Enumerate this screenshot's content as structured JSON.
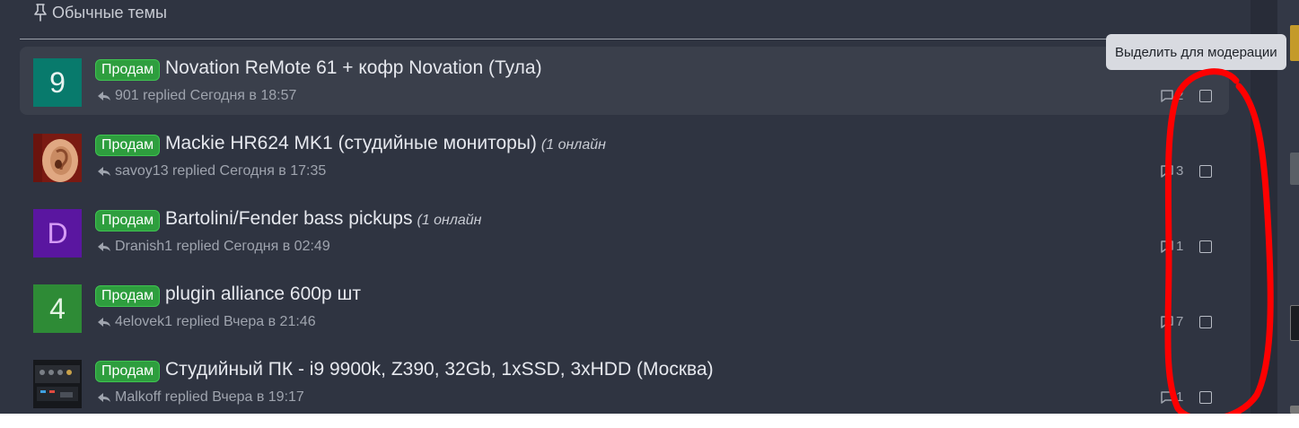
{
  "section": {
    "title": "Обычные темы",
    "icon": "pin-icon"
  },
  "tooltip": "Выделить для модерации",
  "threads": [
    {
      "avatar": {
        "type": "letter",
        "letter": "9",
        "bg": "#087a6c",
        "fg": "#e8f3f0"
      },
      "prefix": "Продам",
      "title": "Novation ReMote 61 + кофр Novation (Тула)",
      "online": "",
      "last_user": "901",
      "replied_word": "replied",
      "time": "Сегодня в 18:57",
      "replies": "2"
    },
    {
      "avatar": {
        "type": "image",
        "name": "ear-photo-avatar"
      },
      "prefix": "Продам",
      "title": "Mackie HR624 MK1 (студийные мониторы)",
      "online": "(1 онлайн",
      "last_user": "savoy13",
      "replied_word": "replied",
      "time": "Сегодня в 17:35",
      "replies": "3"
    },
    {
      "avatar": {
        "type": "letter",
        "letter": "D",
        "bg": "#5a16a0",
        "fg": "#d59bf5"
      },
      "prefix": "Продам",
      "title": "Bartolini/Fender bass pickups",
      "online": "(1 онлайн",
      "last_user": "Dranish1",
      "replied_word": "replied",
      "time": "Сегодня в 02:49",
      "replies": "1"
    },
    {
      "avatar": {
        "type": "letter",
        "letter": "4",
        "bg": "#2e8b36",
        "fg": "#e4f4e4"
      },
      "prefix": "Продам",
      "title": "plugin alliance 600р шт",
      "online": "",
      "last_user": "4elovek1",
      "replied_word": "replied",
      "time": "Вчера в 21:46",
      "replies": "7"
    },
    {
      "avatar": {
        "type": "image",
        "name": "studio-pc-photo-avatar"
      },
      "prefix": "Продам",
      "title": "Студийный ПК - i9 9900k, Z390, 32Gb, 1xSSD, 3xHDD (Москва)",
      "online": "",
      "last_user": "Malkoff",
      "replied_word": "replied",
      "time": "Вчера в 19:17",
      "replies": "1"
    }
  ],
  "colors": {
    "prefix_bg": "#2e9e3e",
    "annotation": "#ff0000",
    "page_bg": "#2f3441"
  }
}
